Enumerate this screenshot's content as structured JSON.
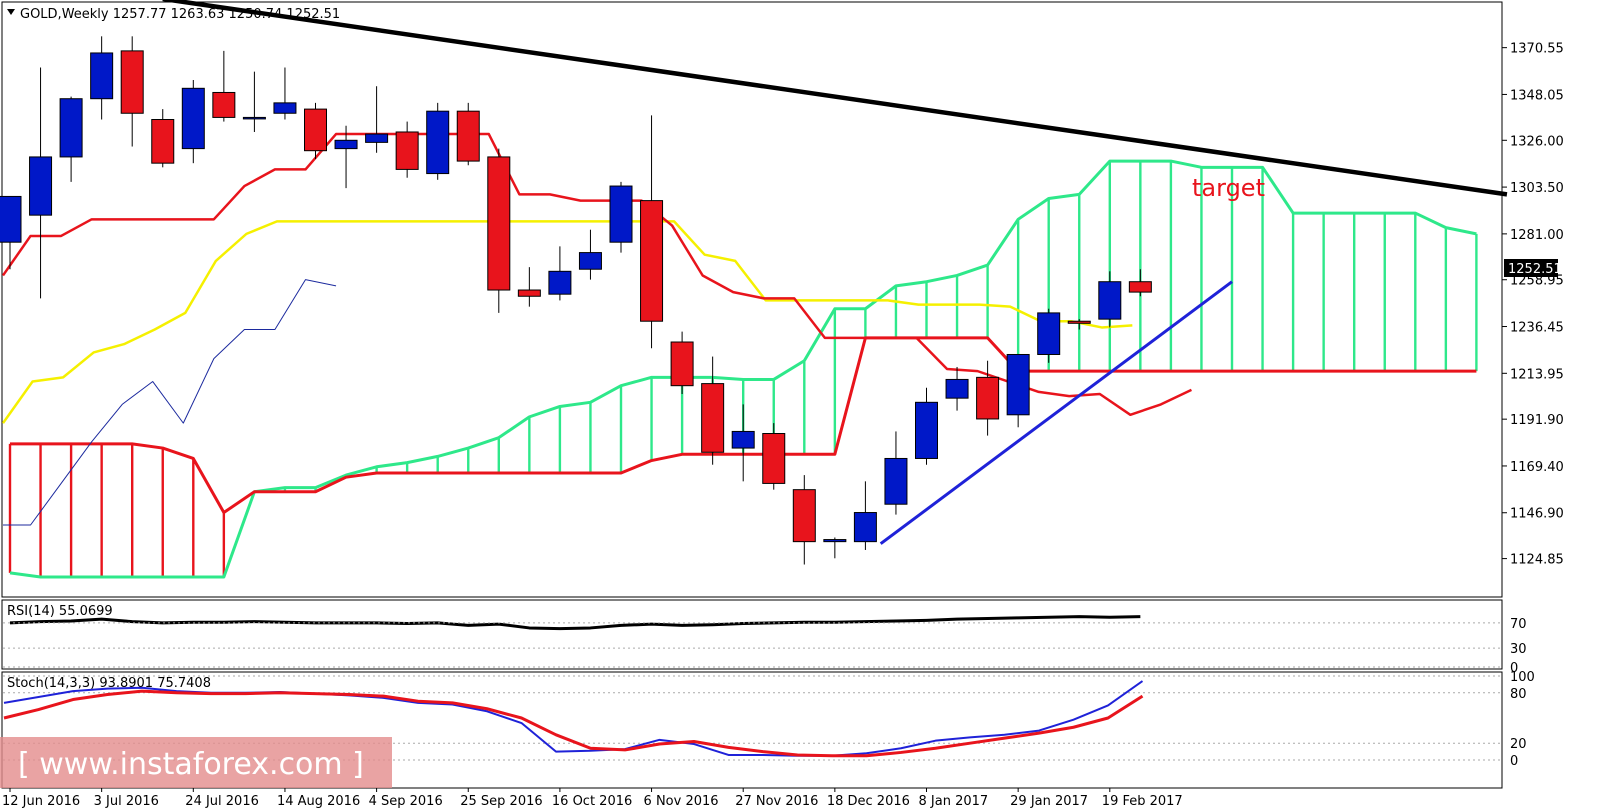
{
  "header": {
    "symbol_title": "GOLD,Weekly  1257.77 1263.63 1250.74 1252.51"
  },
  "annotation": {
    "target_label": "target",
    "target_color": "#e8141c"
  },
  "watermark": {
    "text": "[ www.instaforex.com ]"
  },
  "colors": {
    "bull": "#0018c8",
    "bear": "#e8141c",
    "tenkan": "#e8141c",
    "kijun": "#f5f000",
    "chikou": "#1c2a9e",
    "spanA": "#2ee88a",
    "spanB": "#e8141c",
    "trendline": "#000000",
    "support": "#1f22d8",
    "rsi": "#000000",
    "stochK": "#1f22d8",
    "stochD": "#e8141c",
    "price_tag": "#000000"
  },
  "chart_data": [
    {
      "type": "candlestick",
      "title": "GOLD,Weekly",
      "x_tick_labels": [
        "12 Jun 2016",
        "3 Jul 2016",
        "24 Jul 2016",
        "14 Aug 2016",
        "4 Sep 2016",
        "25 Sep 2016",
        "16 Oct 2016",
        "6 Nov 2016",
        "27 Nov 2016",
        "18 Dec 2016",
        "8 Jan 2017",
        "29 Jan 2017",
        "19 Feb 2017"
      ],
      "y_tick_labels": [
        "1370.55",
        "1348.05",
        "1326.00",
        "1303.50",
        "1281.00",
        "1258.95",
        "1236.45",
        "1213.95",
        "1191.90",
        "1169.40",
        "1146.90",
        "1124.85"
      ],
      "y_range": [
        1116,
        1380
      ],
      "current_price": "1252.51",
      "candles": [
        {
          "o": 1277,
          "h": 1285,
          "l": 1264,
          "c": 1299
        },
        {
          "o": 1290,
          "h": 1361,
          "l": 1250,
          "c": 1318
        },
        {
          "o": 1318,
          "h": 1347,
          "l": 1306,
          "c": 1346
        },
        {
          "o": 1346,
          "h": 1376,
          "l": 1336,
          "c": 1368
        },
        {
          "o": 1369,
          "h": 1376,
          "l": 1323,
          "c": 1339
        },
        {
          "o": 1336,
          "h": 1341,
          "l": 1313,
          "c": 1315
        },
        {
          "o": 1322,
          "h": 1355,
          "l": 1315,
          "c": 1351
        },
        {
          "o": 1349,
          "h": 1369,
          "l": 1335,
          "c": 1337
        },
        {
          "o": 1337,
          "h": 1359,
          "l": 1330,
          "c": 1337
        },
        {
          "o": 1339,
          "h": 1361,
          "l": 1336,
          "c": 1344
        },
        {
          "o": 1341,
          "h": 1344,
          "l": 1317,
          "c": 1321
        },
        {
          "o": 1322,
          "h": 1333,
          "l": 1303,
          "c": 1326
        },
        {
          "o": 1325,
          "h": 1352,
          "l": 1320,
          "c": 1329
        },
        {
          "o": 1330,
          "h": 1335,
          "l": 1308,
          "c": 1312
        },
        {
          "o": 1310,
          "h": 1344,
          "l": 1307,
          "c": 1340
        },
        {
          "o": 1340,
          "h": 1344,
          "l": 1314,
          "c": 1316
        },
        {
          "o": 1318,
          "h": 1322,
          "l": 1243,
          "c": 1254
        },
        {
          "o": 1254,
          "h": 1265,
          "l": 1246,
          "c": 1251
        },
        {
          "o": 1252,
          "h": 1275,
          "l": 1249,
          "c": 1263
        },
        {
          "o": 1264,
          "h": 1283,
          "l": 1259,
          "c": 1272
        },
        {
          "o": 1277,
          "h": 1306,
          "l": 1272,
          "c": 1304
        },
        {
          "o": 1297,
          "h": 1338,
          "l": 1226,
          "c": 1239
        },
        {
          "o": 1229,
          "h": 1234,
          "l": 1204,
          "c": 1208
        },
        {
          "o": 1209,
          "h": 1222,
          "l": 1170,
          "c": 1176
        },
        {
          "o": 1178,
          "h": 1199,
          "l": 1162,
          "c": 1186
        },
        {
          "o": 1185,
          "h": 1190,
          "l": 1158,
          "c": 1161
        },
        {
          "o": 1158,
          "h": 1165,
          "l": 1122,
          "c": 1133
        },
        {
          "o": 1133,
          "h": 1135,
          "l": 1125,
          "c": 1134
        },
        {
          "o": 1133,
          "h": 1162,
          "l": 1129,
          "c": 1147
        },
        {
          "o": 1151,
          "h": 1186,
          "l": 1146,
          "c": 1173
        },
        {
          "o": 1173,
          "h": 1207,
          "l": 1170,
          "c": 1200
        },
        {
          "o": 1202,
          "h": 1217,
          "l": 1196,
          "c": 1211
        },
        {
          "o": 1212,
          "h": 1220,
          "l": 1184,
          "c": 1192
        },
        {
          "o": 1194,
          "h": 1223,
          "l": 1188,
          "c": 1223
        },
        {
          "o": 1223,
          "h": 1245,
          "l": 1219,
          "c": 1243
        },
        {
          "o": 1239,
          "h": 1240,
          "l": 1235,
          "c": 1238
        },
        {
          "o": 1240,
          "h": 1263,
          "l": 1236,
          "c": 1258
        },
        {
          "o": 1258,
          "h": 1264,
          "l": 1251,
          "c": 1253
        }
      ],
      "tenkan": [
        1261,
        1280,
        1280,
        1288,
        1288,
        1288,
        1288,
        1288,
        1304,
        1312,
        1312,
        1329,
        1329,
        1329,
        1329,
        1329,
        1329,
        1300,
        1300,
        1297,
        1297,
        1297,
        1285,
        1261,
        1253,
        1250,
        1250,
        1231,
        1231,
        1231,
        1231,
        1216,
        1215,
        1210,
        1205,
        1203,
        1204,
        1194,
        1199,
        1206
      ],
      "kijun": [
        1190,
        1210,
        1212,
        1224,
        1228,
        1235,
        1243,
        1268,
        1281,
        1287,
        1287,
        1287,
        1287,
        1287,
        1287,
        1287,
        1287,
        1287,
        1287,
        1287,
        1287,
        1287,
        1287,
        1271,
        1268,
        1249,
        1249,
        1249,
        1249,
        1249,
        1247,
        1247,
        1247,
        1246,
        1239,
        1239,
        1236,
        1237
      ],
      "chikou": [
        1141,
        1141,
        1161,
        1181,
        1199,
        1210,
        1190,
        1221,
        1235,
        1235,
        1259,
        1256
      ],
      "spanA": [
        1118,
        1116,
        1116,
        1116,
        1116,
        1116,
        1116,
        1116,
        1157,
        1159,
        1159,
        1165,
        1169,
        1171,
        1174,
        1178,
        1183,
        1193,
        1198,
        1200,
        1208,
        1212,
        1212,
        1212,
        1211,
        1211,
        1220,
        1245,
        1245,
        1256,
        1258,
        1261,
        1266,
        1288,
        1298,
        1300,
        1316,
        1316,
        1316,
        1313,
        1313,
        1313,
        1291,
        1291,
        1291,
        1291,
        1291,
        1284,
        1281
      ],
      "spanB": [
        1180,
        1180,
        1180,
        1180,
        1180,
        1178,
        1173,
        1147,
        1157,
        1157,
        1157,
        1164,
        1166,
        1166,
        1166,
        1166,
        1166,
        1166,
        1166,
        1166,
        1166,
        1172,
        1175,
        1175,
        1175,
        1175,
        1175,
        1175,
        1231,
        1231,
        1231,
        1231,
        1231,
        1215,
        1215,
        1215,
        1215,
        1215,
        1215,
        1215,
        1215,
        1215,
        1215,
        1215,
        1215,
        1215,
        1215,
        1215,
        1215
      ],
      "trendline_upper": [
        {
          "week": 5,
          "price": 1394
        },
        {
          "week": 49,
          "price": 1300
        }
      ],
      "support_line": [
        {
          "week": 28.5,
          "price": 1132
        },
        {
          "week": 40,
          "price": 1258
        }
      ]
    },
    {
      "type": "line",
      "title": "RSI(14) 55.0699",
      "y_tick_labels": [
        "70",
        "30",
        "0"
      ],
      "y_range": [
        0,
        100
      ],
      "values": [
        70,
        72,
        73,
        76,
        72,
        70,
        71,
        71,
        72,
        71,
        70,
        70,
        70,
        69,
        70,
        66,
        68,
        62,
        61,
        62,
        66,
        68,
        66,
        67,
        69,
        70,
        71,
        71,
        72,
        73,
        74,
        76,
        77,
        78,
        79,
        80,
        79,
        80
      ]
    },
    {
      "type": "line",
      "title": "Stoch(14,3,3) 93.8901 75.7408",
      "y_tick_labels": [
        "100",
        "80",
        "20",
        "0"
      ],
      "y_range": [
        0,
        100
      ],
      "series": [
        {
          "values": [
            68,
            75,
            82,
            85,
            86,
            82,
            80,
            80,
            81,
            79,
            77,
            74,
            68,
            66,
            58,
            44,
            10,
            11,
            13,
            24,
            19,
            6,
            6,
            5,
            5,
            8,
            14,
            23,
            27,
            30,
            35,
            48,
            65,
            94
          ]
        },
        {
          "values": [
            50,
            60,
            72,
            78,
            82,
            80,
            79,
            79,
            80,
            79,
            78,
            76,
            70,
            68,
            61,
            50,
            30,
            14,
            12,
            19,
            22,
            15,
            10,
            6,
            5,
            5,
            9,
            14,
            20,
            26,
            32,
            39,
            50,
            76
          ]
        }
      ]
    }
  ]
}
